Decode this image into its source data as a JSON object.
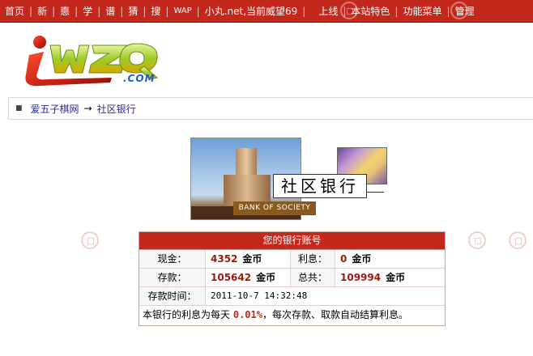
{
  "nav": {
    "items": [
      "首页",
      "新",
      "㥁",
      "学",
      "谱",
      "猜",
      "搜",
      "WAP"
    ],
    "status": "小丸.net,当前威望69",
    "right_items": [
      "上线",
      "本站特色",
      "功能菜单",
      "管理"
    ]
  },
  "logo": {
    "brand": "iwzq",
    "suffix": ".COM"
  },
  "breadcrumb": {
    "home": "爱五子棋网",
    "arrow": "→",
    "current": "社区银行"
  },
  "banner": {
    "title": "社区银行",
    "tag": "BANK OF SOCIETY"
  },
  "account": {
    "header": "您的银行账号",
    "cash_label": "现金：",
    "cash_value": "4352",
    "interest_label": "利息：",
    "interest_value": "0",
    "deposit_label": "存款：",
    "deposit_value": "105642",
    "total_label": "总共：",
    "total_value": "109994",
    "unit": "金币",
    "time_label": "存款时间：",
    "time_value": "2011-10-7 14:32:48",
    "note_prefix": "本银行的利息为每天",
    "note_rate": "0.01%",
    "note_suffix": "，每次存款、取款自动结算利息。"
  },
  "colors": {
    "brand_red": "#c4271b",
    "value_red": "#9b1a0f",
    "link_blue": "#2a2aa0"
  }
}
